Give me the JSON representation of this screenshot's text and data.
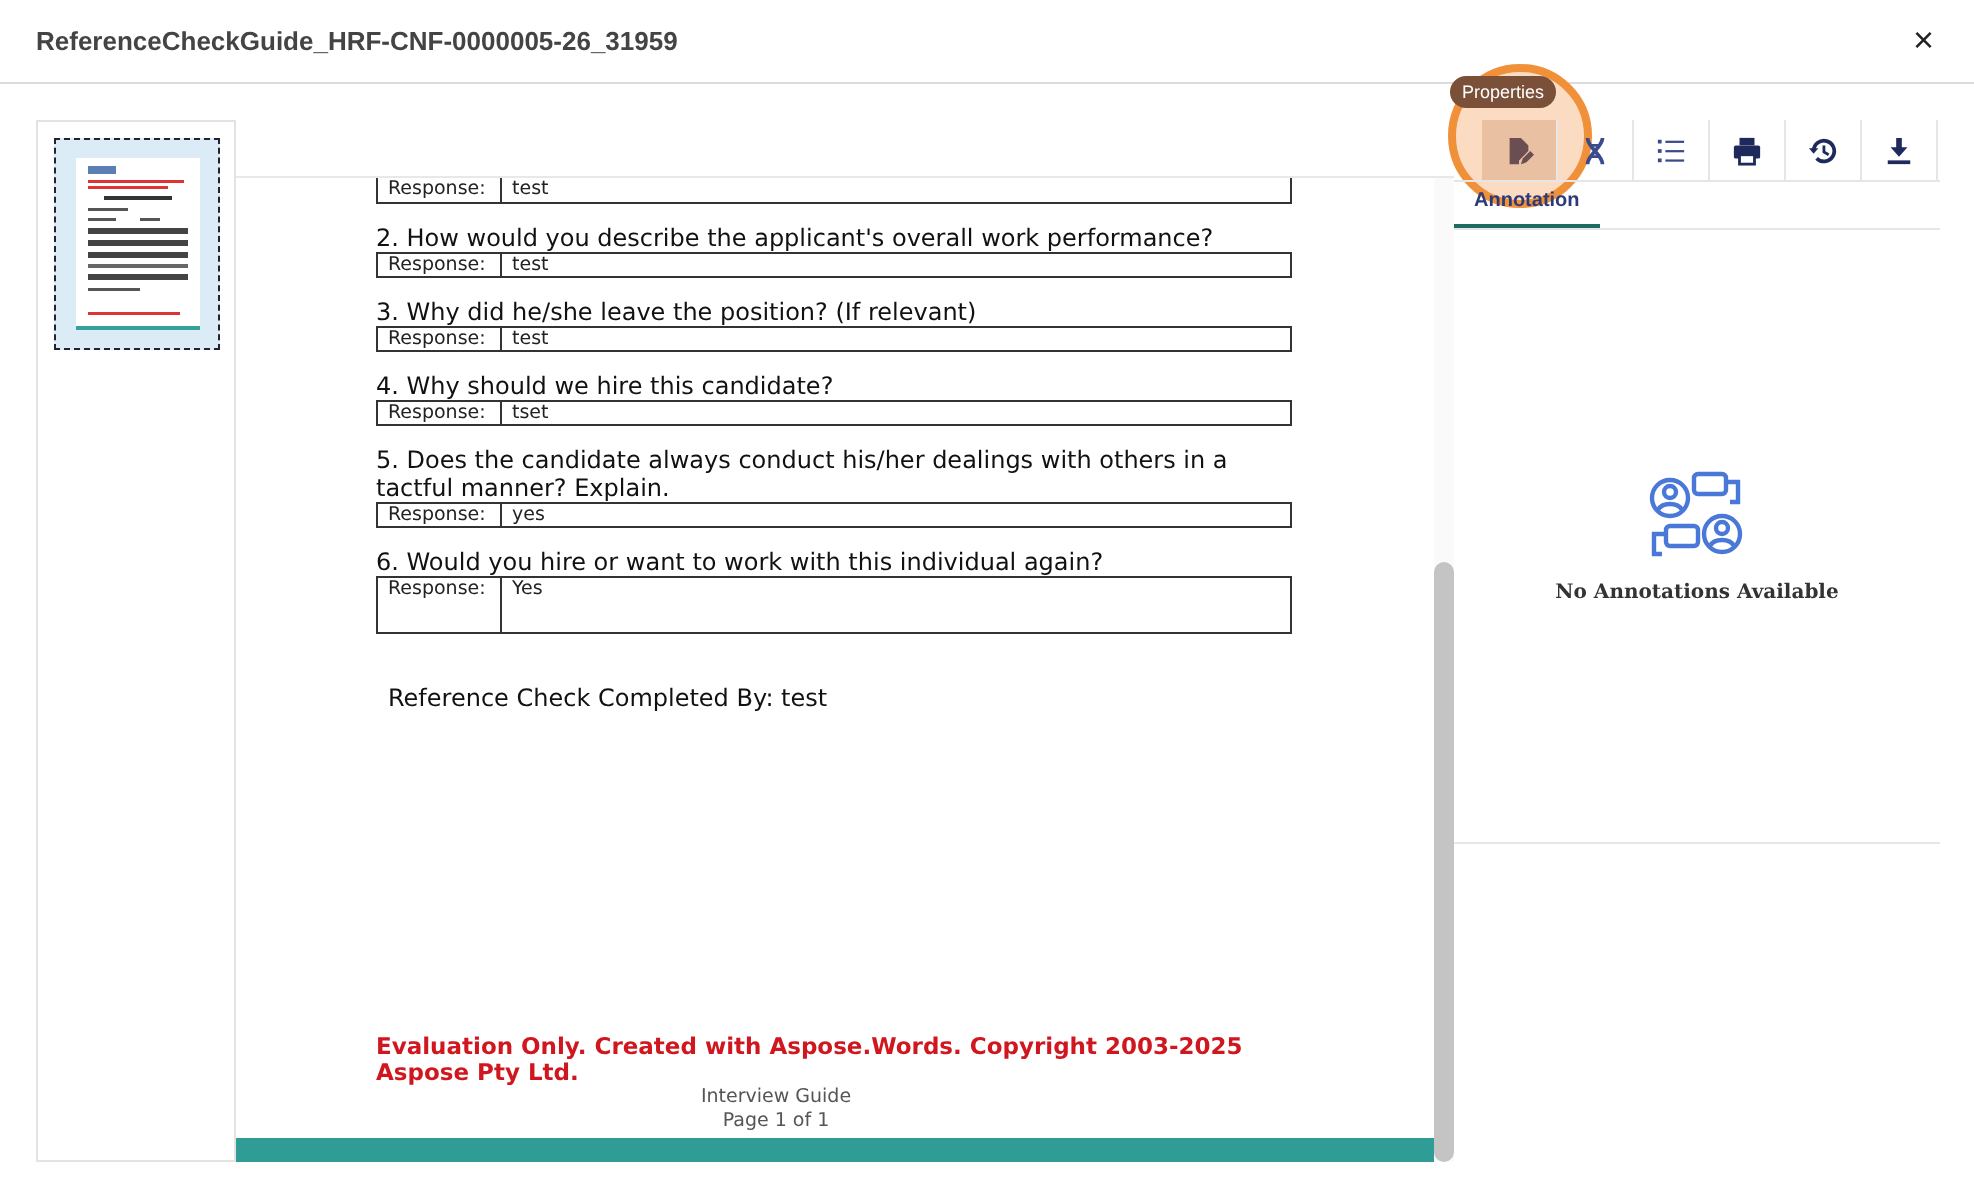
{
  "window": {
    "title": "ReferenceCheckGuide_HRF-CNF-0000005-26_31959",
    "close": "×"
  },
  "toolbar": [
    {
      "kind": "properties",
      "hovered": true,
      "tooltip": "Properties"
    },
    {
      "kind": "strand",
      "hovered": false
    },
    {
      "kind": "list",
      "hovered": false
    },
    {
      "kind": "print",
      "hovered": false
    },
    {
      "kind": "history",
      "hovered": false
    },
    {
      "kind": "download",
      "hovered": false
    }
  ],
  "tabs": [
    {
      "label": "Annotation",
      "selected": true
    }
  ],
  "annotations": {
    "empty_text": "No Annotations Available"
  },
  "document": {
    "items": [
      {
        "kind": "single",
        "label": "Response:",
        "answer": "test"
      },
      {
        "kind": "single",
        "question": "2. How would you describe the applicant's overall work performance?",
        "label": "Response:",
        "answer": "test"
      },
      {
        "kind": "single",
        "question": "3. Why did he/she leave the position? (If relevant)",
        "label": "Response:",
        "answer": "test"
      },
      {
        "kind": "single",
        "question": "4. Why should we hire this candidate?",
        "label": "Response:",
        "answer": "tset"
      },
      {
        "kind": "single",
        "question": "5. Does the candidate always conduct his/her dealings with others in a tactful manner? Explain.",
        "label": "Response:",
        "answer": "yes"
      },
      {
        "kind": "tall",
        "question": "6. Would you hire or want to work with this individual again?",
        "label": "Response:",
        "answer": "Yes"
      }
    ],
    "completed_by": "Reference Check Completed By: test",
    "evaluation_notice": "Evaluation Only. Created with Aspose.Words. Copyright 2003-2025 Aspose Pty Ltd.",
    "footer": [
      "Interview Guide",
      "Page 1 of 1"
    ]
  }
}
